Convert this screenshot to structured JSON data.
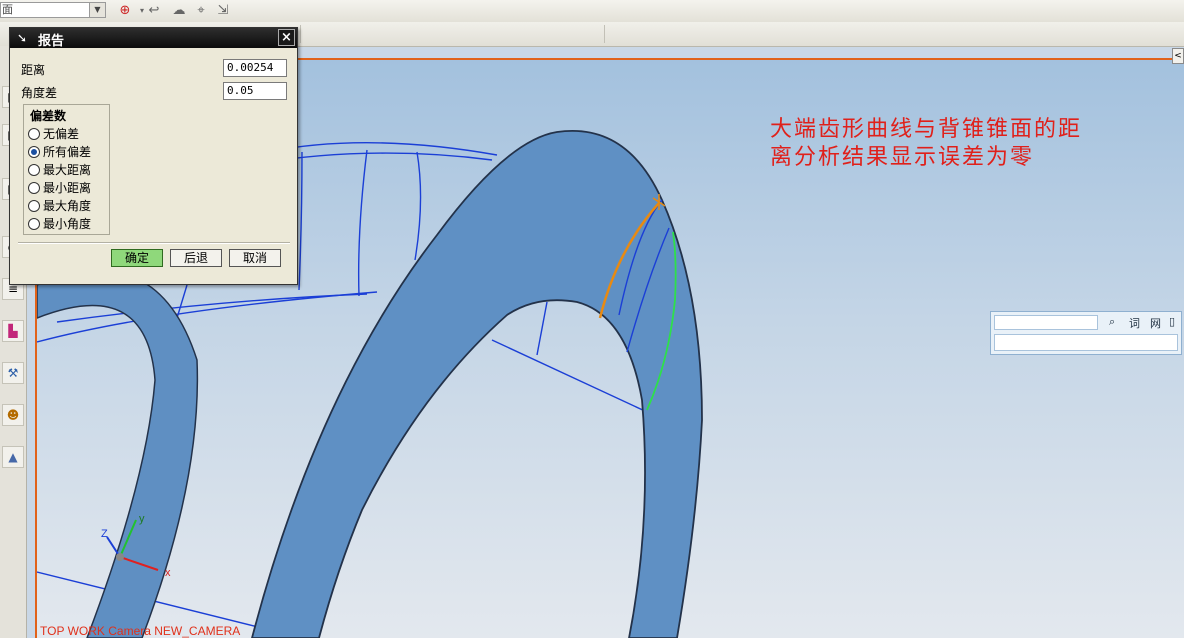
{
  "toolbar": {
    "combo_value": "面"
  },
  "annotation": {
    "text": "大端齿形曲线与背锥锥面的距\n离分析结果显示误差为零"
  },
  "viewport": {
    "view_label": "TOP WORK Camera NEW_CAMERA"
  },
  "triad": {
    "x": "x",
    "y": "y",
    "z": "Z"
  },
  "dictionary": {
    "search_icon": "search-icon",
    "link1": "词",
    "link2": "网"
  },
  "dialog": {
    "title": "报告",
    "fields": [
      {
        "label": "距离",
        "value": "0.00254"
      },
      {
        "label": "角度差",
        "value": "0.05"
      }
    ],
    "group_title": "偏差数",
    "options": [
      {
        "label": "无偏差",
        "selected": false
      },
      {
        "label": "所有偏差",
        "selected": true
      },
      {
        "label": "最大距离",
        "selected": false
      },
      {
        "label": "最小距离",
        "selected": false
      },
      {
        "label": "最大角度",
        "selected": false
      },
      {
        "label": "最小角度",
        "selected": false
      }
    ],
    "buttons": {
      "ok": "确定",
      "back": "后退",
      "cancel": "取消"
    }
  },
  "colors": {
    "accent_orange": "#e1621a",
    "annotation_red": "#e0201a",
    "ring_blue": "#5f8fc2"
  }
}
